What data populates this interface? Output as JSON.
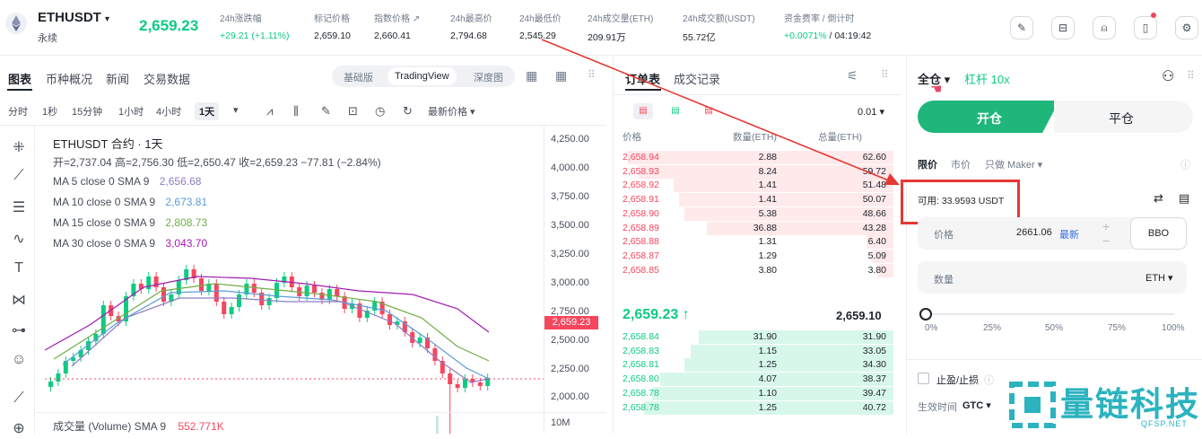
{
  "header": {
    "symbol": "ETHUSDT",
    "symbol_type": "永续",
    "last_price": "2,659.23",
    "stats": [
      {
        "label": "24h涨跌幅",
        "value": "+29.21 (+1.11%)"
      },
      {
        "label": "标记价格",
        "value": "2,659.10"
      },
      {
        "label": "指数价格",
        "value": "2,660.41"
      },
      {
        "label": "24h最高价",
        "value": "2,794.68"
      },
      {
        "label": "24h最低价",
        "value": "2,545.29"
      },
      {
        "label": "24h成交量(ETH)",
        "value": "209.91万"
      },
      {
        "label": "24h成交额(USDT)",
        "value": "55.72亿"
      },
      {
        "label": "资金费率 / 倒计时",
        "value": "+0.0071%",
        "value2": " / 04:19:42"
      }
    ]
  },
  "chart": {
    "tabs": [
      "图表",
      "币种概况",
      "新闻",
      "交易数据"
    ],
    "views": [
      "基础版",
      "TradingView",
      "深度图"
    ],
    "timeframes": [
      "分时",
      "1秒",
      "15分钟",
      "1小时",
      "4小时",
      "1天"
    ],
    "price_type": "最新价格 ▾",
    "title": "ETHUSDT 合约 · 1天",
    "ohlc": "开=2,737.04 高=2,756.30 低=2,650.47 收=2,659.23 −77.81 (−2.84%)",
    "ma": [
      {
        "label": "MA 5 close 0 SMA 9",
        "value": "2,656.68",
        "color": "#8e7cc3"
      },
      {
        "label": "MA 10 close 0 SMA 9",
        "value": "2,673.81",
        "color": "#5b9bd5"
      },
      {
        "label": "MA 15 close 0 SMA 9",
        "value": "2,808.73",
        "color": "#70ad47"
      },
      {
        "label": "MA 30 close 0 SMA 9",
        "value": "3,043.70",
        "color": "#a21caf"
      }
    ],
    "yticks": [
      "4,250.00",
      "4,000.00",
      "3,750.00",
      "3,500.00",
      "3,250.00",
      "3,000.00",
      "2,750.00",
      "2,500.00",
      "2,250.00",
      "2,000.00"
    ],
    "current_price": "2,659.23",
    "volume_label": "成交量 (Volume) SMA 9",
    "volume_value": "552.771K",
    "volume_axis": "10M"
  },
  "orderbook": {
    "tabs": [
      "订单表",
      "成交记录"
    ],
    "precision": "0.01 ▾",
    "headers": [
      "价格",
      "数量(ETH)",
      "总量(ETH)"
    ],
    "asks": [
      {
        "price": "2,658.94",
        "qty": "2.88",
        "total": "62.60",
        "depth": 0.98
      },
      {
        "price": "2,658.93",
        "qty": "8.24",
        "total": "59.72",
        "depth": 0.94
      },
      {
        "price": "2,658.92",
        "qty": "1.41",
        "total": "51.48",
        "depth": 0.81
      },
      {
        "price": "2,658.91",
        "qty": "1.41",
        "total": "50.07",
        "depth": 0.79
      },
      {
        "price": "2,658.90",
        "qty": "5.38",
        "total": "48.66",
        "depth": 0.77
      },
      {
        "price": "2,658.89",
        "qty": "36.88",
        "total": "43.28",
        "depth": 0.69
      },
      {
        "price": "2,658.88",
        "qty": "1.31",
        "total": "6.40",
        "depth": 0.1
      },
      {
        "price": "2,658.87",
        "qty": "1.29",
        "total": "5.09",
        "depth": 0.08
      },
      {
        "price": "2,658.85",
        "qty": "3.80",
        "total": "3.80",
        "depth": 0.06
      }
    ],
    "mid_price": "2,659.23 ↑",
    "mark_price": "2,659.10",
    "bids": [
      {
        "price": "2,658.84",
        "qty": "31.90",
        "total": "31.90",
        "depth": 0.72
      },
      {
        "price": "2,658.83",
        "qty": "1.15",
        "total": "33.05",
        "depth": 0.75
      },
      {
        "price": "2,658.81",
        "qty": "1.25",
        "total": "34.30",
        "depth": 0.77
      },
      {
        "price": "2,658.80",
        "qty": "4.07",
        "total": "38.37",
        "depth": 0.86
      },
      {
        "price": "2,658.78",
        "qty": "1.10",
        "total": "39.47",
        "depth": 0.89
      },
      {
        "price": "2,658.78",
        "qty": "1.25",
        "total": "40.72",
        "depth": 0.92
      }
    ]
  },
  "trade": {
    "margin_mode": "全仓 ▾",
    "leverage": "杠杆 10x",
    "open_label": "开仓",
    "close_label": "平仓",
    "order_types": [
      "限价",
      "市价",
      "只做 Maker ▾"
    ],
    "available": "可用: 33.9593 USDT",
    "price_label": "价格",
    "price_value": "2661.06",
    "latest": "最新",
    "bbo": "BBO",
    "qty_label": "数量",
    "qty_unit": "ETH ▾",
    "slider_value": 0,
    "slider_marks": [
      "0%",
      "25%",
      "50%",
      "75%",
      "100%"
    ],
    "tpsl_label": "止盈/止损",
    "tif_label": "生效时间",
    "tif_value": "GTC ▾"
  },
  "watermark": {
    "text": "量链科技",
    "sub": "QFSP.NET"
  },
  "colors": {
    "up": "#0ecb81",
    "down": "#f6465d",
    "annotation": "#e53935"
  }
}
